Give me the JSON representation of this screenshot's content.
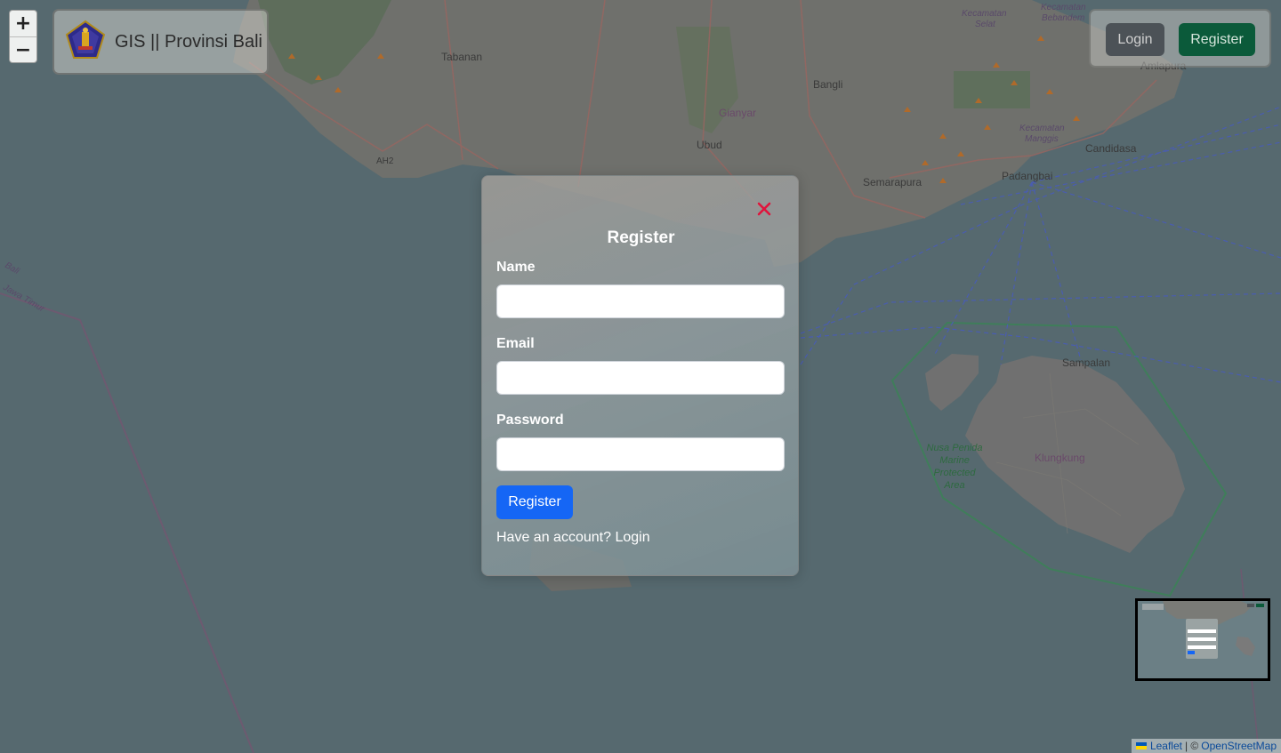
{
  "map": {
    "places": [
      "Tabanan",
      "Bangli",
      "Gianyar",
      "Ubud",
      "Semarapura",
      "Padangbai",
      "Candidasa",
      "Amlapura",
      "Sampalan",
      "Klungkung",
      "Kecamatan Selat",
      "Kecamatan Bebandem",
      "Kecamatan Manggis",
      "Nusa Penida Marine Protected Area",
      "Jawa Timur",
      "Bali",
      "AH2"
    ]
  },
  "zoom": {
    "in_label": "+",
    "out_label": "−"
  },
  "brand": {
    "title": "GIS || Provinsi Bali",
    "logo_icon": "bali-province-emblem"
  },
  "auth": {
    "login_label": "Login",
    "register_label": "Register"
  },
  "modal": {
    "title": "Register",
    "fields": [
      {
        "label": "Name",
        "value": "",
        "placeholder": ""
      },
      {
        "label": "Email",
        "value": "",
        "placeholder": ""
      },
      {
        "label": "Password",
        "value": "",
        "placeholder": ""
      }
    ],
    "submit_label": "Register",
    "switch_prompt": "Have an account?",
    "switch_link": "Login",
    "close_icon": "close-x-icon"
  },
  "attribution": {
    "leaflet": "Leaflet",
    "separator": "| ©",
    "osm": "OpenStreetMap"
  },
  "colors": {
    "primary": "#1566f5",
    "close": "#e0143c",
    "success": "#0b5a3a",
    "secondary": "#4c5257",
    "sea": "#56696f",
    "land": "#6f706c"
  }
}
